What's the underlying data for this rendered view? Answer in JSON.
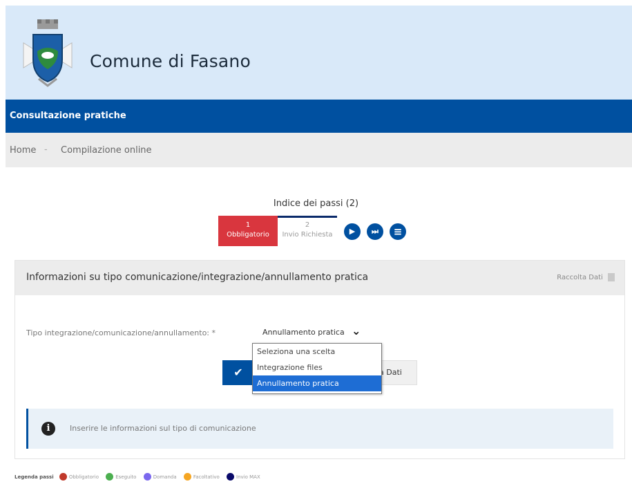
{
  "header": {
    "site_title": "Comune di Fasano",
    "colors": {
      "background": "#d9e9f9",
      "navbar": "#0050a0"
    }
  },
  "navbar": {
    "title": "Consultazione pratiche"
  },
  "breadcrumb": {
    "home": "Home",
    "separator": "-",
    "current": "Compilazione online"
  },
  "steps": {
    "title": "Indice dei passi (2)",
    "items": [
      {
        "number": "1",
        "label": "Obbligatorio",
        "color": "#d9363e"
      },
      {
        "number": "2",
        "label": "Invio Richiesta"
      }
    ],
    "controls": [
      {
        "icon": "play-icon",
        "glyph": "▶"
      },
      {
        "icon": "skip-end-icon",
        "glyph": "⏭"
      },
      {
        "icon": "menu-icon",
        "glyph": "≡"
      }
    ]
  },
  "card": {
    "title": "Informazioni su tipo comunicazione/integrazione/annullamento pratica",
    "meta": "Raccolta Dati",
    "field": {
      "label": "Tipo integrazione/comunicazione/annullamento: *",
      "value": "Annullamento pratica",
      "options": [
        "Seleziona una scelta",
        "Integrazione files",
        "Annullamento pratica"
      ],
      "selected_index": 2
    },
    "button_partial_label": "a Dati",
    "info": "Inserire le informazioni sul tipo di comunicazione"
  },
  "legend": {
    "title": "Legenda passi",
    "items": [
      {
        "label": "Obbligatorio",
        "color": "#c0392b"
      },
      {
        "label": "Eseguito",
        "color": "#4caf50"
      },
      {
        "label": "Domanda",
        "color": "#7b68ee"
      },
      {
        "label": "Facoltativo",
        "color": "#f5a623"
      },
      {
        "label": "Invio MAX",
        "color": "#0a0a6a"
      }
    ]
  }
}
